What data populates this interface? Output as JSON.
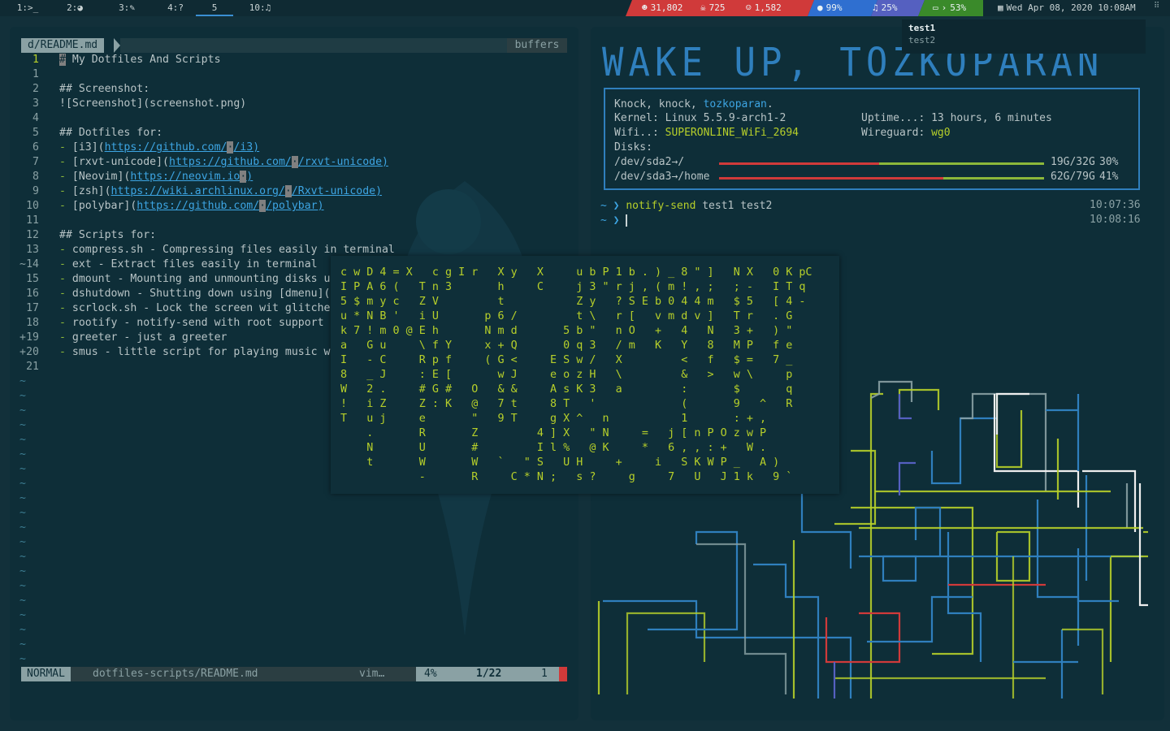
{
  "bar": {
    "workspaces": [
      {
        "id": "1:",
        "icon": ">_",
        "active": false
      },
      {
        "id": "2:",
        "icon": "firefox-icon",
        "active": false
      },
      {
        "id": "3:",
        "icon": "pencil-icon",
        "active": false
      },
      {
        "id": "4:",
        "icon": "?",
        "active": false
      },
      {
        "id": "5",
        "icon": "",
        "active": true
      },
      {
        "id": "10:",
        "icon": "music-icon",
        "active": false
      }
    ],
    "status": {
      "reddit": "31,802",
      "skull": "725",
      "smile": "1,582",
      "cpu": "99%",
      "music": "25%",
      "battery_label": "53%",
      "datetime": "Wed Apr 08, 2020 10:08AM"
    },
    "colors": {
      "red": "#d03a3a",
      "blue": "#2f6fd0",
      "purple": "#5560c0",
      "green": "#3a8a2a"
    }
  },
  "notification": {
    "title": "test1",
    "body": "test2"
  },
  "nvim": {
    "tab_label": "d/README.md",
    "buffers_label": "buffers",
    "lines": [
      {
        "n": "1",
        "sign": "",
        "text": "# My Dotfiles And Scripts",
        "cursor": true
      },
      {
        "n": "1",
        "sign": "",
        "text": ""
      },
      {
        "n": "2",
        "sign": "",
        "text": "## Screenshot:"
      },
      {
        "n": "3",
        "sign": "",
        "text": "![Screenshot](screenshot.png)"
      },
      {
        "n": "4",
        "sign": "",
        "text": ""
      },
      {
        "n": "5",
        "sign": "",
        "text": "## Dotfiles for:"
      },
      {
        "n": "6",
        "sign": "",
        "text": "- [i3](",
        "url": "https://github.com/",
        "after": "/i3)"
      },
      {
        "n": "7",
        "sign": "",
        "text": "- [rxvt-unicode](",
        "url": "https://github.com/",
        "after": "/rxvt-unicode)"
      },
      {
        "n": "8",
        "sign": "",
        "text": "- [Neovim](",
        "url": "https://neovim.io",
        "after": ")"
      },
      {
        "n": "9",
        "sign": "",
        "text": "- [zsh](",
        "url": "https://wiki.archlinux.org/",
        "after": "/Rxvt-unicode)"
      },
      {
        "n": "10",
        "sign": "",
        "text": "- [polybar](",
        "url": "https://github.com/",
        "after": "/polybar)"
      },
      {
        "n": "11",
        "sign": "",
        "text": ""
      },
      {
        "n": "12",
        "sign": "",
        "text": "## Scripts for:"
      },
      {
        "n": "13",
        "sign": "",
        "text": "- compress.sh - Compressing files easily in terminal"
      },
      {
        "n": "14",
        "sign": "~",
        "text": "- ext - Extract files easily in terminal"
      },
      {
        "n": "15",
        "sign": "",
        "text": "- dmount - Mounting and unmounting disks u"
      },
      {
        "n": "16",
        "sign": "",
        "text": "- dshutdown - Shutting down using [dmenu]("
      },
      {
        "n": "17",
        "sign": "",
        "text": "- scrlock.sh - Lock the screen wit glitche"
      },
      {
        "n": "18",
        "sign": "",
        "text": "- rootify - notify-send with root support"
      },
      {
        "n": "19",
        "sign": "+",
        "text": "- greeter - just a greeter"
      },
      {
        "n": "20",
        "sign": "+",
        "text": "- smus - little script for playing music w"
      },
      {
        "n": "21",
        "sign": "",
        "text": ""
      }
    ],
    "statusline": {
      "mode": "NORMAL",
      "file": "dotfiles-scripts/README.md",
      "filetype": "vim…",
      "percent": "4%",
      "position": "1/22",
      "col": "1"
    }
  },
  "term": {
    "banner": "WAKE UP, TOZKOPARAN",
    "knock": "Knock, knock, ",
    "user": "tozkoparan",
    "kernel_label": "Kernel:",
    "kernel": "Linux 5.5.9-arch1-2",
    "uptime_label": "Uptime...:",
    "uptime": "13 hours, 6 minutes",
    "wifi_label": "Wifi..:",
    "wifi": "SUPERONLINE_WiFi_2694",
    "wg_label": "Wireguard:",
    "wg": "wg0",
    "disks_label": "Disks:",
    "disks": [
      {
        "name": "/dev/sda2→/",
        "size": "19G/32G",
        "pct": "30%",
        "fill": 0.3
      },
      {
        "name": "/dev/sda3→/home",
        "size": "62G/79G",
        "pct": "41%",
        "fill": 0.41
      }
    ],
    "prompt": "~ ❯",
    "cmd1_cmd": "notify-send",
    "cmd1_args": " test1 test2",
    "time1": "10:07:36",
    "time2": "10:08:16"
  },
  "matrix": {
    "rows": [
      "c w D 4 = X   c g I r   X y   X     u b P 1 b . ) _ 8 \" ]   N X   0 K pC",
      "I P A 6 (   T n 3       h     C     j 3 \" r j , ( m ! , ;   ; -   I T q",
      "5 $ m y c   Z V         t           Z y   ? S E b 0 4 4 m   $ 5   [ 4 -",
      "u * N B '   i U       p 6 /         t \\   r [   v m d v ]   T r   . G",
      "k 7 ! m 0 @ E h       N m d       5 b \"   n O   +   4   N   3 +   ) \"",
      "a   G u     \\ f Y     x + Q       0 q 3   / m   K   Y   8   M P   f e",
      "I   - C     R p f     ( G <     E S w /   X         <   f   $ =   7 _",
      "8   _ J     : E [       w J     e o z H   \\         &   >   w \\     p",
      "W   2 .     # G #   O   & &     A s K 3   a         :       $       q",
      "!   i Z     Z : K   @   7 t     8 T   '             (       9   ^   R",
      "T   u j     e       \"   9 T     g X ^   n           1       : + ,",
      "    .       R       Z         4 ] X   \" N     =   j [ n P O z w P",
      "    N       U       #         I l %   @ K     *   6 , , : +   W .",
      "    t       W       W   `   \" S   U H     +     i   S K W P _   A )",
      "            -       R     C * N ;   s ?     g     7   U   J 1 k   9 `"
    ]
  }
}
